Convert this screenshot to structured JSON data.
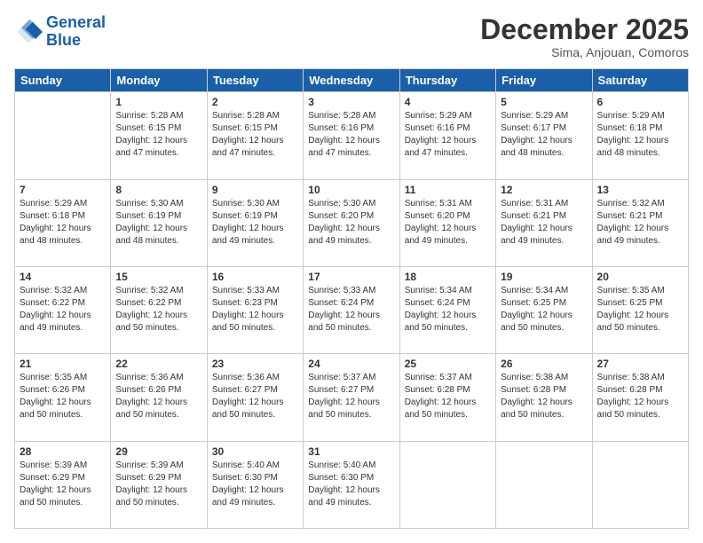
{
  "logo": {
    "line1": "General",
    "line2": "Blue"
  },
  "title": "December 2025",
  "location": "Sima, Anjouan, Comoros",
  "days_header": [
    "Sunday",
    "Monday",
    "Tuesday",
    "Wednesday",
    "Thursday",
    "Friday",
    "Saturday"
  ],
  "weeks": [
    [
      {
        "day": "",
        "info": ""
      },
      {
        "day": "1",
        "info": "Sunrise: 5:28 AM\nSunset: 6:15 PM\nDaylight: 12 hours\nand 47 minutes."
      },
      {
        "day": "2",
        "info": "Sunrise: 5:28 AM\nSunset: 6:15 PM\nDaylight: 12 hours\nand 47 minutes."
      },
      {
        "day": "3",
        "info": "Sunrise: 5:28 AM\nSunset: 6:16 PM\nDaylight: 12 hours\nand 47 minutes."
      },
      {
        "day": "4",
        "info": "Sunrise: 5:29 AM\nSunset: 6:16 PM\nDaylight: 12 hours\nand 47 minutes."
      },
      {
        "day": "5",
        "info": "Sunrise: 5:29 AM\nSunset: 6:17 PM\nDaylight: 12 hours\nand 48 minutes."
      },
      {
        "day": "6",
        "info": "Sunrise: 5:29 AM\nSunset: 6:18 PM\nDaylight: 12 hours\nand 48 minutes."
      }
    ],
    [
      {
        "day": "7",
        "info": "Sunrise: 5:29 AM\nSunset: 6:18 PM\nDaylight: 12 hours\nand 48 minutes."
      },
      {
        "day": "8",
        "info": "Sunrise: 5:30 AM\nSunset: 6:19 PM\nDaylight: 12 hours\nand 48 minutes."
      },
      {
        "day": "9",
        "info": "Sunrise: 5:30 AM\nSunset: 6:19 PM\nDaylight: 12 hours\nand 49 minutes."
      },
      {
        "day": "10",
        "info": "Sunrise: 5:30 AM\nSunset: 6:20 PM\nDaylight: 12 hours\nand 49 minutes."
      },
      {
        "day": "11",
        "info": "Sunrise: 5:31 AM\nSunset: 6:20 PM\nDaylight: 12 hours\nand 49 minutes."
      },
      {
        "day": "12",
        "info": "Sunrise: 5:31 AM\nSunset: 6:21 PM\nDaylight: 12 hours\nand 49 minutes."
      },
      {
        "day": "13",
        "info": "Sunrise: 5:32 AM\nSunset: 6:21 PM\nDaylight: 12 hours\nand 49 minutes."
      }
    ],
    [
      {
        "day": "14",
        "info": "Sunrise: 5:32 AM\nSunset: 6:22 PM\nDaylight: 12 hours\nand 49 minutes."
      },
      {
        "day": "15",
        "info": "Sunrise: 5:32 AM\nSunset: 6:22 PM\nDaylight: 12 hours\nand 50 minutes."
      },
      {
        "day": "16",
        "info": "Sunrise: 5:33 AM\nSunset: 6:23 PM\nDaylight: 12 hours\nand 50 minutes."
      },
      {
        "day": "17",
        "info": "Sunrise: 5:33 AM\nSunset: 6:24 PM\nDaylight: 12 hours\nand 50 minutes."
      },
      {
        "day": "18",
        "info": "Sunrise: 5:34 AM\nSunset: 6:24 PM\nDaylight: 12 hours\nand 50 minutes."
      },
      {
        "day": "19",
        "info": "Sunrise: 5:34 AM\nSunset: 6:25 PM\nDaylight: 12 hours\nand 50 minutes."
      },
      {
        "day": "20",
        "info": "Sunrise: 5:35 AM\nSunset: 6:25 PM\nDaylight: 12 hours\nand 50 minutes."
      }
    ],
    [
      {
        "day": "21",
        "info": "Sunrise: 5:35 AM\nSunset: 6:26 PM\nDaylight: 12 hours\nand 50 minutes."
      },
      {
        "day": "22",
        "info": "Sunrise: 5:36 AM\nSunset: 6:26 PM\nDaylight: 12 hours\nand 50 minutes."
      },
      {
        "day": "23",
        "info": "Sunrise: 5:36 AM\nSunset: 6:27 PM\nDaylight: 12 hours\nand 50 minutes."
      },
      {
        "day": "24",
        "info": "Sunrise: 5:37 AM\nSunset: 6:27 PM\nDaylight: 12 hours\nand 50 minutes."
      },
      {
        "day": "25",
        "info": "Sunrise: 5:37 AM\nSunset: 6:28 PM\nDaylight: 12 hours\nand 50 minutes."
      },
      {
        "day": "26",
        "info": "Sunrise: 5:38 AM\nSunset: 6:28 PM\nDaylight: 12 hours\nand 50 minutes."
      },
      {
        "day": "27",
        "info": "Sunrise: 5:38 AM\nSunset: 6:28 PM\nDaylight: 12 hours\nand 50 minutes."
      }
    ],
    [
      {
        "day": "28",
        "info": "Sunrise: 5:39 AM\nSunset: 6:29 PM\nDaylight: 12 hours\nand 50 minutes."
      },
      {
        "day": "29",
        "info": "Sunrise: 5:39 AM\nSunset: 6:29 PM\nDaylight: 12 hours\nand 50 minutes."
      },
      {
        "day": "30",
        "info": "Sunrise: 5:40 AM\nSunset: 6:30 PM\nDaylight: 12 hours\nand 49 minutes."
      },
      {
        "day": "31",
        "info": "Sunrise: 5:40 AM\nSunset: 6:30 PM\nDaylight: 12 hours\nand 49 minutes."
      },
      {
        "day": "",
        "info": ""
      },
      {
        "day": "",
        "info": ""
      },
      {
        "day": "",
        "info": ""
      }
    ]
  ]
}
